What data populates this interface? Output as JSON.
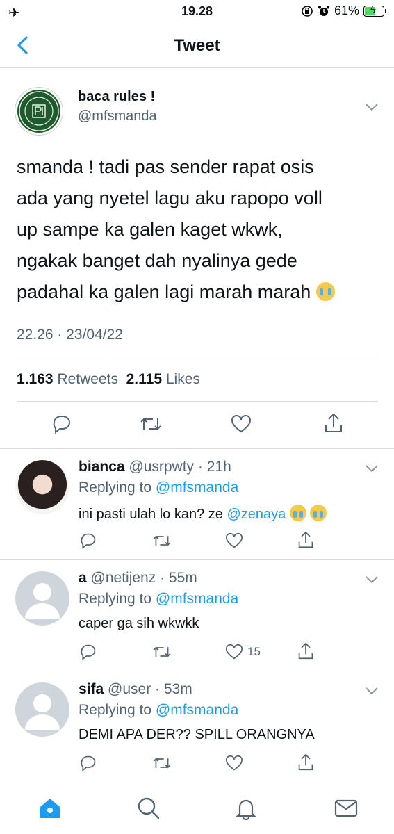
{
  "status_bar": {
    "time": "19.28",
    "battery": "61%",
    "battery_level": 0.61
  },
  "header": {
    "title": "Tweet"
  },
  "main_tweet": {
    "display_name": "baca rules !",
    "handle": "@mfsmanda",
    "text_lines": [
      "smanda ! tadi pas sender rapat osis",
      "ada yang nyetel lagu aku rapopo voll",
      "up sampe ka galen kaget wkwk,",
      "ngakak banget dah nyalinya gede",
      "padahal ka galen lagi marah marah"
    ],
    "timestamp": "22.26 · 23/04/22",
    "retweets_count": "1.163",
    "retweets_label": "Retweets",
    "likes_count": "2.115",
    "likes_label": "Likes"
  },
  "replies": [
    {
      "name": "bianca",
      "handle": "@usrpwty",
      "time": "· 21h",
      "replying_label": "Replying to",
      "replying_to": "@mfsmanda",
      "text": "ini pasti ulah lo kan? ze",
      "mention": "@zenaya",
      "likes": ""
    },
    {
      "name": "a",
      "handle": "@netijenz",
      "time": "· 55m",
      "replying_label": "Replying to",
      "replying_to": "@mfsmanda",
      "text": "caper ga sih wkwkk",
      "mention": "",
      "likes": "15"
    },
    {
      "name": "sifa",
      "handle": "@user",
      "time": "· 53m",
      "replying_label": "Replying to",
      "replying_to": "@mfsmanda",
      "text": "DEMI APA DER?? SPILL ORANGNYA",
      "mention": "",
      "likes": ""
    }
  ],
  "colors": {
    "accent": "#1d9bf0",
    "muted": "#536471",
    "divider": "#d9dde0",
    "text": "#0f1419"
  },
  "icons": [
    "airplane-icon",
    "lock-rotation-icon",
    "alarm-icon",
    "battery-icon",
    "back-chevron-icon",
    "chevron-down-icon",
    "reply-icon",
    "retweet-icon",
    "like-icon",
    "share-icon",
    "home-icon",
    "search-icon",
    "notifications-icon",
    "messages-icon"
  ]
}
